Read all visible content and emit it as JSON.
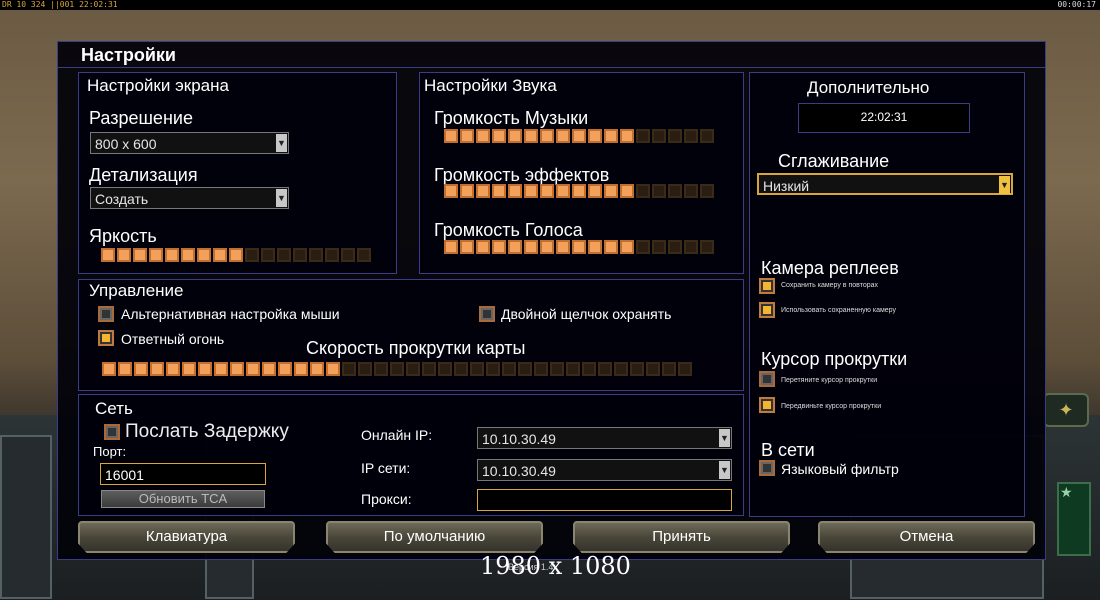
{
  "hud": {
    "clock_left": "DR 10  324  ||001  22:02:31",
    "clock_right": "00:00:17"
  },
  "dialog": {
    "title": "Настройки"
  },
  "screen": {
    "title": "Настройки экрана",
    "resolution_label": "Разрешение",
    "resolution_value": "800 x 600",
    "detail_label": "Детализация",
    "detail_value": "Создать",
    "brightness_label": "Яркость",
    "brightness_level": 0.5
  },
  "sound": {
    "title": "Настройки Звука",
    "music_label": "Громкость Музыки",
    "music_level": 0.7,
    "effects_label": "Громкость эффектов",
    "effects_level": 0.7,
    "voice_label": "Громкость Голоса",
    "voice_level": 0.7
  },
  "advanced": {
    "title": "Дополнительно",
    "time": "22:02:31",
    "antialias_label": "Сглаживание",
    "antialias_value": "Низкий",
    "replay_camera_title": "Камера реплеев",
    "save_camera_label": "Сохранить камеру в повторах",
    "use_saved_camera_label": "Использовать сохраненную камеру",
    "scroll_cursor_title": "Курсор прокрутки",
    "drag_cursor_label": "Перетяните курсор прокрутки",
    "move_cursor_label": "Передвиньте курсор прокрутки",
    "online_title": "В сети",
    "language_filter_label": "Языковый фильтр"
  },
  "control": {
    "title": "Управление",
    "alt_mouse_label": "Альтернативная настройка мыши",
    "double_click_label": "Двойной щелчок охранять",
    "return_fire_label": "Ответный огонь",
    "scroll_speed_label": "Скорость прокрутки карты",
    "scroll_speed_level": 0.4
  },
  "network": {
    "title": "Сеть",
    "send_delay_label": "Послать Задержку",
    "port_label": "Порт:",
    "port_value": "16001",
    "update_tca_label": "Обновить TCA",
    "online_ip_label": "Онлайн IP:",
    "online_ip_value": "10.10.30.49",
    "lan_ip_label": "IP сети:",
    "lan_ip_value": "10.10.30.49",
    "proxy_label": "Прокси:",
    "proxy_value": ""
  },
  "buttons": {
    "keyboard": "Клавиатура",
    "defaults": "По умолчанию",
    "accept": "Принять",
    "cancel": "Отмена"
  },
  "overlay": {
    "resolution_text": "1980 x 1080",
    "version_text": "Версия 1.4"
  }
}
